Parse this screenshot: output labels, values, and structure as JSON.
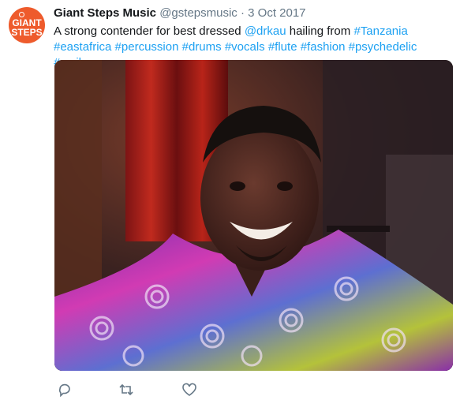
{
  "tweet": {
    "avatar": {
      "line1": "GIANT",
      "line2": "STEPS"
    },
    "author": "Giant Steps Music",
    "handle": "@gstepsmusic",
    "separator": "·",
    "date": "3 Oct 2017",
    "text_parts": {
      "t1": "A strong contender for best dressed ",
      "mention": "@drkau",
      "t2": " hailing from ",
      "h1": "#Tanzania",
      "h2": "#eastafrica",
      "h3": "#percussion",
      "h4": "#drums",
      "h5": "#vocals",
      "h6": "#flute",
      "h7": "#fashion",
      "h8": "#psychedelic",
      "h9": "#smile"
    },
    "media": {
      "icon": "photo"
    },
    "actions": {
      "reply_icon": "reply-icon",
      "retweet_icon": "retweet-icon",
      "like_icon": "heart-icon"
    },
    "colors": {
      "link": "#1da1f2",
      "muted": "#657786",
      "avatar_bg": "#ee5b2c"
    }
  }
}
